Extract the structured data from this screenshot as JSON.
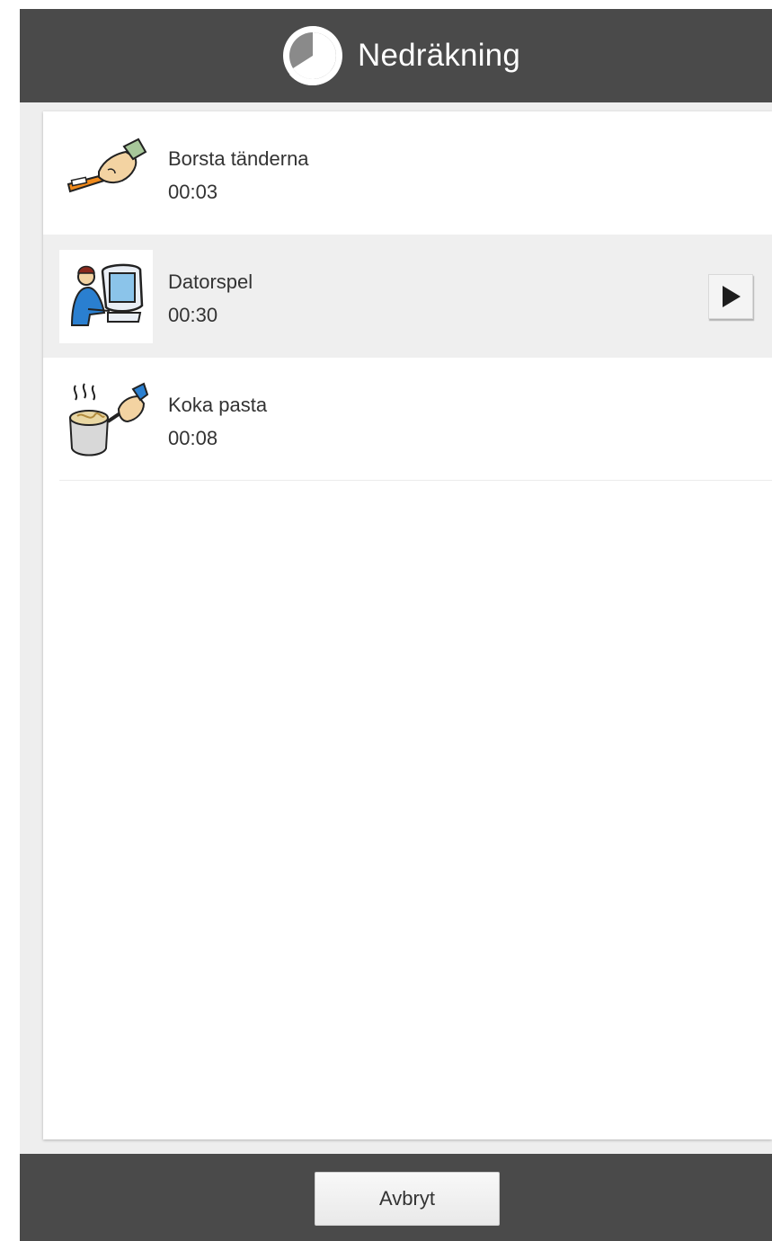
{
  "header": {
    "title": "Nedräkning",
    "icon": "countdown-timer-icon"
  },
  "list": {
    "items": [
      {
        "label": "Borsta tänderna",
        "time": "00:03",
        "icon": "toothbrush-icon",
        "highlighted": false
      },
      {
        "label": "Datorspel",
        "time": "00:30",
        "icon": "computer-player-icon",
        "highlighted": true,
        "action_icon": "play-icon"
      },
      {
        "label": "Koka pasta",
        "time": "00:08",
        "icon": "cooking-pot-icon",
        "highlighted": false
      }
    ]
  },
  "footer": {
    "cancel_label": "Avbryt"
  },
  "colors": {
    "bar": "#4a4a4a",
    "highlight": "#efefef",
    "text": "#333333"
  }
}
